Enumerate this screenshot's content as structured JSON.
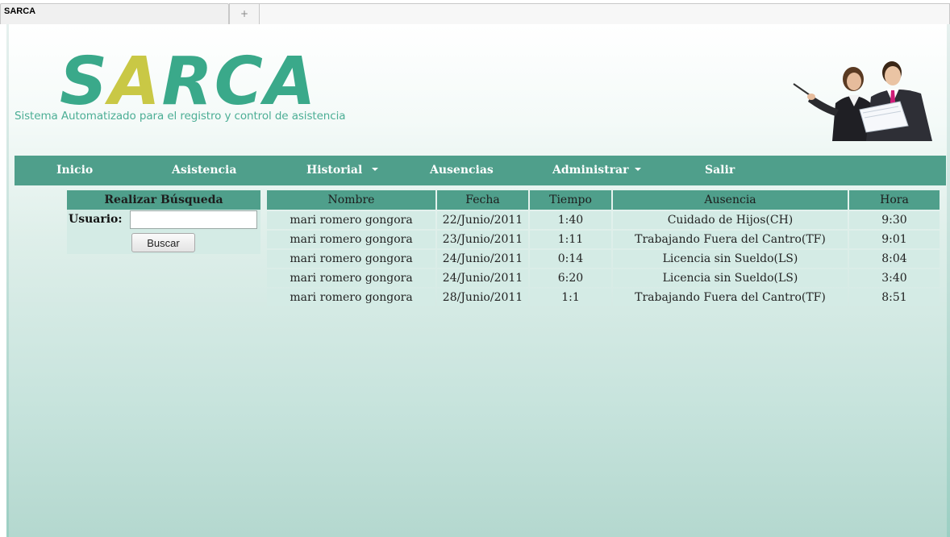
{
  "browser": {
    "tab_title": "SARCA",
    "new_tab_symbol": "+"
  },
  "header": {
    "logo_letters": [
      "S",
      "A",
      "R",
      "C",
      "A"
    ],
    "logo_colors": [
      "#3aa98a",
      "#c9c845",
      "#3aa98a",
      "#3aa98a",
      "#3aa98a"
    ],
    "subtitle": "Sistema Automatizado para el registro y control de asistencia"
  },
  "nav": {
    "items": [
      {
        "label": "Inicio",
        "dropdown": false
      },
      {
        "label": "Asistencia",
        "dropdown": false
      },
      {
        "label": "Historial",
        "dropdown": true
      },
      {
        "label": "Ausencias",
        "dropdown": false
      },
      {
        "label": "Administrar",
        "dropdown": true
      },
      {
        "label": "Salir",
        "dropdown": false
      }
    ]
  },
  "search": {
    "title": "Realizar Búsqueda",
    "user_label": "Usuario:",
    "user_value": "",
    "button_label": "Buscar"
  },
  "table": {
    "columns": [
      "Nombre",
      "Fecha",
      "Tiempo",
      "Ausencia",
      "Hora"
    ],
    "rows": [
      [
        "mari romero gongora",
        "22/Junio/2011",
        "1:40",
        "Cuidado de Hijos(CH)",
        "9:30"
      ],
      [
        "mari romero gongora",
        "23/Junio/2011",
        "1:11",
        "Trabajando Fuera del Cantro(TF)",
        "9:01"
      ],
      [
        "mari romero gongora",
        "24/Junio/2011",
        "0:14",
        "Licencia sin Sueldo(LS)",
        "8:04"
      ],
      [
        "mari romero gongora",
        "24/Junio/2011",
        "6:20",
        "Licencia sin Sueldo(LS)",
        "3:40"
      ],
      [
        "mari romero gongora",
        "28/Junio/2011",
        "1:1",
        "Trabajando Fuera del Cantro(TF)",
        "8:51"
      ]
    ]
  },
  "colors": {
    "accent": "#4f9f8b",
    "cell_bg": "#d4ebe5",
    "subtitle": "#4cae95"
  }
}
